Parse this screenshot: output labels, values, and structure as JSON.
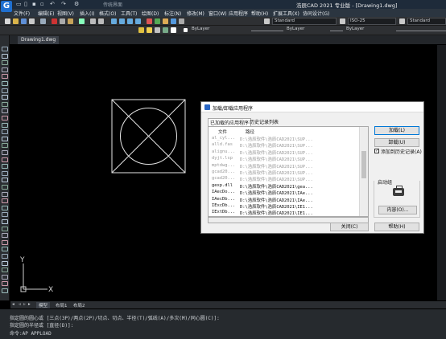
{
  "title_bar": {
    "logo": "G",
    "workspace": "传统界面",
    "title": "浩辰CAD 2021 专业版 - [Drawing1.dwg]"
  },
  "menu": [
    "文件(F)",
    "编辑(E)",
    "视图(V)",
    "插入(I)",
    "格式(O)",
    "工具(T)",
    "绘图(D)",
    "标注(N)",
    "修改(M)",
    "窗口(W)",
    "应用程序",
    "帮助(H)",
    "扩展工具(X)",
    "协同设计(G)"
  ],
  "toolbar1": {
    "text_style": "Standard",
    "dim_style": "ISO-25",
    "table_style": "Standard"
  },
  "toolbar2": {
    "color": "ByLayer",
    "linetype": "ByLayer",
    "lineweight": "ByLayer"
  },
  "doc_tab": "Drawing1.dwg",
  "canvas": {
    "ucs_y": "Y",
    "ucs_x": "X"
  },
  "layout_tabs": {
    "model": "模型",
    "layout1": "布局1",
    "layout2": "布局2"
  },
  "command": {
    "line1": "指定圆的圆心或 [三点(3P)/两点(2P)/切点、切点、半径(T)/弧线(A)/多次(M)/同心圆(C)]:",
    "line2": "指定圆的半径或 [直径(D)]:",
    "line3": "命令:AP APPLOAD"
  },
  "dialog": {
    "title": "加载/卸载应用程序",
    "tab_loaded": "已加载的应用程序",
    "tab_history": "历史记录列表",
    "col_file": "文件",
    "col_path": "路径",
    "rows": [
      {
        "file": "al_cyl...",
        "path": "D:\\浩辰软件\\浩辰CAD2021\\SUP...",
        "dim": true
      },
      {
        "file": "alld.fas",
        "path": "D:\\浩辰软件\\浩辰CAD2021\\SUP...",
        "dim": true
      },
      {
        "file": "alignu...",
        "path": "D:\\浩辰软件\\浩辰CAD2021\\SUP...",
        "dim": true
      },
      {
        "file": "dyjt.lsp",
        "path": "D:\\浩辰软件\\浩辰CAD2021\\SUP...",
        "dim": true
      },
      {
        "file": "mptdwg...",
        "path": "D:\\浩辰软件\\浩辰CAD2021\\SUP...",
        "dim": true
      },
      {
        "file": "gcad20...",
        "path": "D:\\浩辰软件\\浩辰CAD2021\\SUP...",
        "dim": true
      },
      {
        "file": "gcad20...",
        "path": "D:\\浩辰软件\\浩辰CAD2021\\SUP...",
        "dim": true
      },
      {
        "file": "gexp.dll",
        "path": "D:\\浩辰软件\\浩辰CAD2021\\gea...",
        "dim": false
      },
      {
        "file": "IAecDo...",
        "path": "D:\\浩辰软件\\浩辰CAD2021\\IAe...",
        "dim": false
      },
      {
        "file": "IAecDb...",
        "path": "D:\\浩辰软件\\浩辰CAD2021\\IAe...",
        "dim": false
      },
      {
        "file": "IExcDb...",
        "path": "D:\\浩辰软件\\浩辰CAD2021\\IE1...",
        "dim": false
      },
      {
        "file": "IExtDb...",
        "path": "D:\\浩辰软件\\浩辰CAD2021\\IE1...",
        "dim": false
      }
    ],
    "btn_load_default": "加载(L)",
    "btn_unload": "卸载(U)",
    "checkbox_label": "添加到历史记录(A)",
    "checkbox_checked": true,
    "startup_label": "启动组",
    "btn_contents": "内容(O)...",
    "btn_close": "关闭(C)",
    "btn_help": "帮助(H)"
  }
}
